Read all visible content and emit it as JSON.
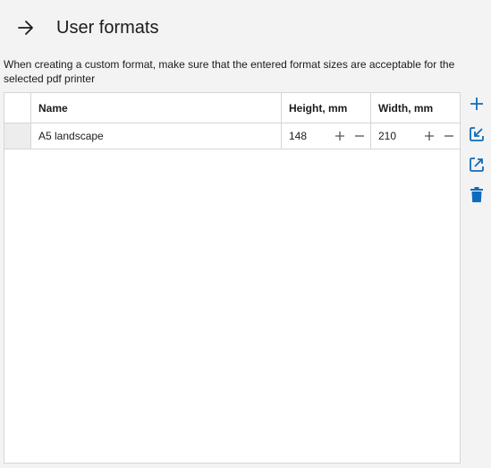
{
  "header": {
    "title": "User formats",
    "back_icon": "arrow-right-icon"
  },
  "description": "When creating a custom format, make sure that the entered format sizes are acceptable for the selected pdf printer",
  "table": {
    "columns": [
      "Name",
      "Height, mm",
      "Width, mm"
    ],
    "rows": [
      {
        "name": "A5 landscape",
        "height": "148",
        "width": "210"
      }
    ]
  },
  "toolbar": {
    "icons": [
      "plus-icon",
      "import-icon",
      "export-icon",
      "trash-icon"
    ]
  },
  "colors": {
    "accent": "#0f6cbd",
    "background": "#f3f3f3",
    "border": "#d6d6d6"
  }
}
